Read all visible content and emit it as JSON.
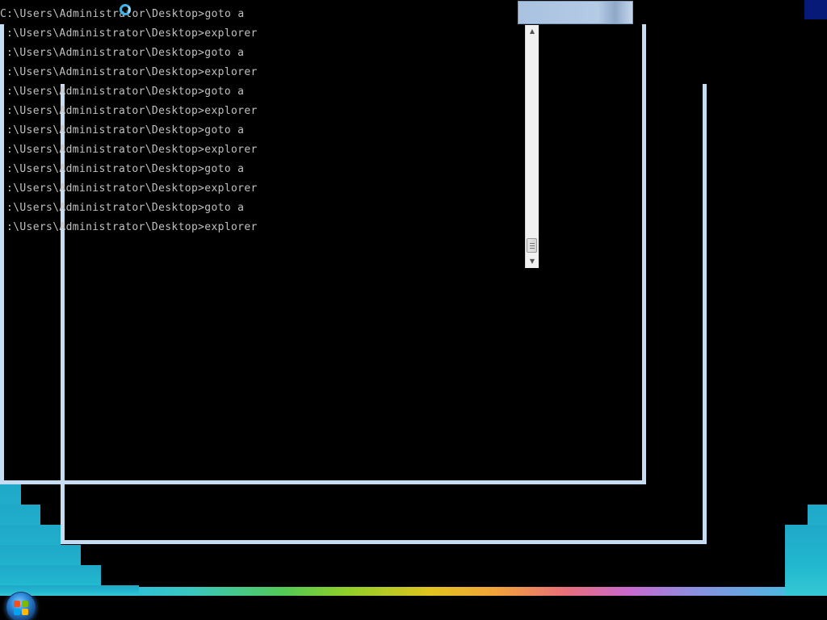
{
  "console": {
    "lines": [
      "C:\\Users\\Administrator\\Desktop>goto a",
      ":\\Users\\Administrator\\Desktop>explorer",
      ":\\Users\\Administrator\\Desktop>goto a",
      ":\\Users\\Administrator\\Desktop>explorer",
      ":\\Users\\Administrator\\Desktop>goto a",
      ":\\Users\\Administrator\\Desktop>explorer",
      ":\\Users\\Administrator\\Desktop>goto a",
      ":\\Users\\Administrator\\Desktop>explorer",
      ":\\Users\\Administrator\\Desktop>goto a",
      ":\\Users\\Administrator\\Desktop>explorer",
      ":\\Users\\Administrator\\Desktop>goto a",
      ":\\Users\\Administrator\\Desktop>explorer"
    ],
    "text_color": "#c0c0c0",
    "background_color": "#000000"
  },
  "scrollbar": {
    "up_arrow": "▲",
    "down_arrow": "▼"
  },
  "taskbar": {
    "start_button": "start-orb-icon"
  },
  "colors": {
    "window_frame": "#c6dcf2",
    "wallpaper_cyan": "#22b8cf",
    "wallpaper_navy": "#071a78"
  },
  "icons": {
    "busy_cursor": "busy-ring-icon"
  }
}
